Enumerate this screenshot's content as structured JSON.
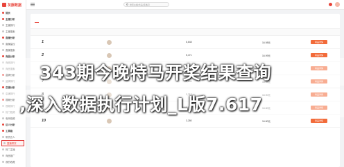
{
  "app": {
    "logo_text": "灰豚数据"
  },
  "topbar": {
    "search_placeholder": "搜索主播/商品/直播间"
  },
  "sidebar": {
    "items": [
      {
        "label": "首页"
      },
      {
        "label": "主播分析"
      },
      {
        "label": "主播排行"
      },
      {
        "label": "主播搜索"
      },
      {
        "label": "直播分析"
      },
      {
        "label": "直播监控"
      },
      {
        "label": "直播搜索"
      },
      {
        "label": "商品分析"
      },
      {
        "label": "商品排行"
      },
      {
        "label": "商品搜索"
      },
      {
        "label": "品牌分析"
      },
      {
        "label": "品牌排行"
      },
      {
        "label": "店铺分析"
      },
      {
        "label": "店铺排行"
      },
      {
        "label": "视频分析"
      },
      {
        "label": "视频排行"
      },
      {
        "label": "热门视频"
      },
      {
        "label": "电商视频"
      },
      {
        "label": "达人分析"
      },
      {
        "label": "工具箱"
      },
      {
        "label": "带货达人"
      },
      {
        "label": "直播带货"
      },
      {
        "label": "热门主播"
      },
      {
        "label": "商品推广"
      },
      {
        "label": "我的收藏"
      },
      {
        "label": "我的关注"
      }
    ]
  },
  "overlay": {
    "line1": "343期今晚特马开奖结果查询",
    "line2": ",深入数据执行计划_L版7.617"
  },
  "table": {
    "rows": [
      {
        "rank": "1",
        "fans": "6,648",
        "price": "16.98元",
        "action": "商品详情"
      },
      {
        "rank": "2",
        "fans": "5,471",
        "price": "16.99元",
        "action": "商品详情"
      },
      {
        "rank": "3",
        "fans": "4,523",
        "price": "16.90元",
        "action": "商品详情"
      },
      {
        "rank": "7",
        "fans": "3,804",
        "price": "16.98元",
        "action": "商品详情"
      },
      {
        "rank": "8",
        "fans": "3,712",
        "price": "16.90元",
        "action": "商品详情"
      },
      {
        "rank": "9",
        "fans": "3,557",
        "price": "16.80元",
        "action": "商品详情"
      },
      {
        "rank": "10",
        "fans": "3,280",
        "price": "16.80元",
        "action": "商品详情"
      }
    ]
  },
  "colors": {
    "accent": "#e8443a",
    "button": "#f26b3a",
    "highlight_border": "#e03030"
  },
  "icons": {
    "logo": "brand-logo",
    "search": "search-icon",
    "menu": "menu-icon"
  }
}
